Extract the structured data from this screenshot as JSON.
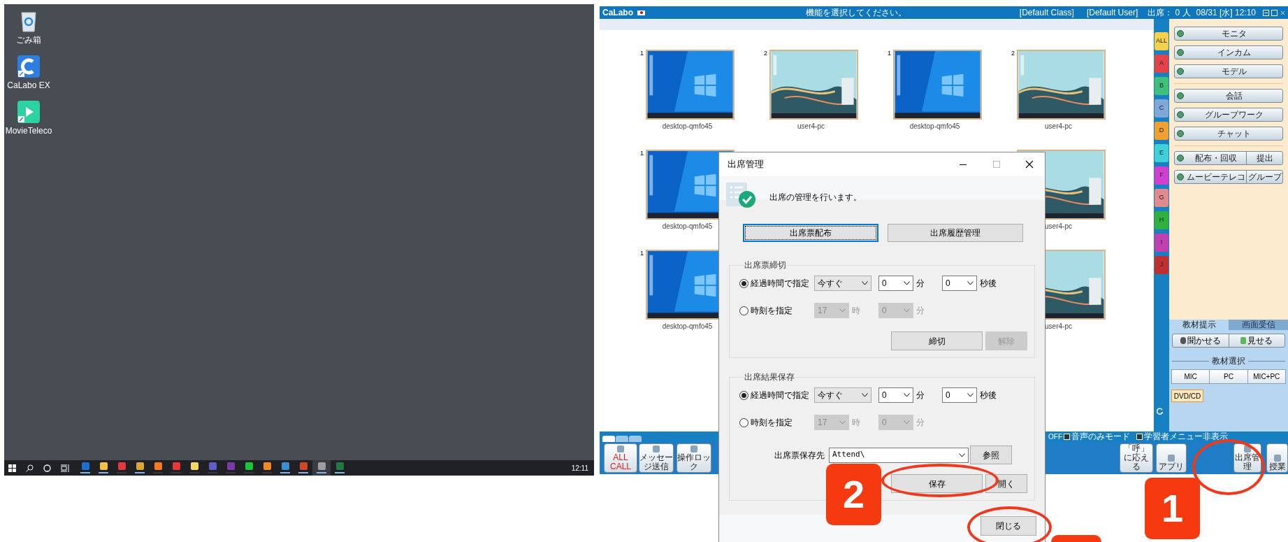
{
  "desktop": {
    "icons": [
      {
        "label": "ごみ箱",
        "kind": "trash"
      },
      {
        "label": "CaLabo EX",
        "kind": "calabo"
      },
      {
        "label": "MovieTeleco",
        "kind": "movie"
      }
    ],
    "taskbar": {
      "apps": [
        {
          "color": "#1e6fd0",
          "running": true
        },
        {
          "color": "#f5c242",
          "running": true
        },
        {
          "color": "#e5383b",
          "running": false
        },
        {
          "color": "#dda533",
          "running": true
        },
        {
          "color": "#f57a1f",
          "running": false
        },
        {
          "color": "#e53935",
          "running": false
        },
        {
          "color": "#f7d867",
          "running": false
        },
        {
          "color": "#5b5fc7",
          "running": false
        },
        {
          "color": "#7c3aa6",
          "running": false
        },
        {
          "color": "#19c43c",
          "running": false
        },
        {
          "color": "#f08a24",
          "running": false
        },
        {
          "color": "#3e8ed0",
          "running": true
        },
        {
          "color": "#d24726",
          "running": true
        },
        {
          "color": "#9aa0a6",
          "running": true
        },
        {
          "color": "#1f7a43",
          "running": true
        }
      ],
      "clock": "12:11"
    }
  },
  "app": {
    "title_bar": {
      "app_name": "CaLabo",
      "message": "機能を選択してください。",
      "class_name": "[Default Class]",
      "user_name": "[Default User]",
      "attendance": "出席： 0 人",
      "datetime": "08/31 [水] 12:10"
    },
    "thumbnail_rows": [
      {
        "cells": [
          {
            "number": "1",
            "label": "desktop-qmfo45"
          },
          {
            "number": "2",
            "label": "user4-pc"
          },
          {
            "number": "1",
            "label": "desktop-qmfo45"
          },
          {
            "number": "2",
            "label": "user4-pc"
          }
        ]
      },
      {
        "cells": [
          {
            "number": "1",
            "label": "desktop-qmfo45"
          },
          {
            "label": "user4-pc"
          }
        ]
      },
      {
        "cells": [
          {
            "number": "1",
            "label": "desktop-qmfo45"
          },
          {
            "label": "user4-pc"
          }
        ]
      }
    ],
    "group_tabs": [
      {
        "label": "ALL",
        "color": "#f5d04a"
      },
      {
        "label": "A",
        "color": "#e0434a"
      },
      {
        "label": "B",
        "color": "#3fbf7f"
      },
      {
        "label": "C",
        "color": "#7fa7d8"
      },
      {
        "label": "D",
        "color": "#f0a030"
      },
      {
        "label": "E",
        "color": "#3fd0d8"
      },
      {
        "label": "F",
        "color": "#d040d0"
      },
      {
        "label": "G",
        "color": "#e08a90"
      },
      {
        "label": "H",
        "color": "#30b040"
      },
      {
        "label": "I",
        "color": "#c040b0"
      },
      {
        "label": "J",
        "color": "#c03030"
      }
    ],
    "function_sections": [
      [
        {
          "label": "モニタ"
        },
        {
          "label": "インカム"
        },
        {
          "label": "モデル"
        }
      ],
      [
        {
          "label": "会話"
        },
        {
          "label": "グループワーク"
        },
        {
          "label": "チャット"
        }
      ],
      [
        {
          "label": "配布・回収",
          "side": "提出"
        },
        {
          "label": "ムービーテレコ",
          "side": "グループ"
        }
      ]
    ],
    "material_tabs": [
      {
        "label": "教材提示",
        "selected": true
      },
      {
        "label": "画面受信",
        "selected": false
      }
    ],
    "present_buttons": [
      "聞かせる",
      "見せる"
    ],
    "material_select_label": "教材選択",
    "sources": [
      {
        "label": "MIC",
        "selected": false
      },
      {
        "label": "PC",
        "selected": false
      },
      {
        "label": "MIC+PC",
        "selected": false
      }
    ],
    "extra_source": {
      "label": "DVD/CD",
      "selected": true
    },
    "view_tabs": [
      {
        "selected": true
      },
      {
        "selected": false
      },
      {
        "selected": false
      }
    ],
    "status_text": "OFF",
    "toggles": [
      {
        "label": "音声のみモード",
        "checked": true
      },
      {
        "label": "学習者メニュー非表示",
        "checked": true
      }
    ],
    "left_buttons": [
      {
        "label": "ALL CALL",
        "alert": true
      },
      {
        "label": "メッセージ送信",
        "alert": false
      },
      {
        "label": "操作ロック",
        "alert": false
      }
    ],
    "right_buttons": [
      {
        "label": "「呼」に応える"
      },
      {
        "label": "アプリ"
      },
      {
        "label": "出席管理"
      },
      {
        "label": "授業"
      }
    ]
  },
  "dialog": {
    "title": "出席管理",
    "description": "出席の管理を行います。",
    "top_buttons": [
      {
        "label": "出席票配布",
        "focused": true
      },
      {
        "label": "出席履歴管理",
        "focused": false
      }
    ],
    "groups": [
      {
        "title": "出席票締切",
        "rows": [
          {
            "label": "経過時間で指定",
            "selected": true,
            "disabled": false,
            "fields": [
              {
                "value": "今すぐ"
              },
              {
                "value": "0",
                "unit": "分"
              },
              {
                "value": "0",
                "unit": "秒後"
              }
            ]
          },
          {
            "label": "時刻を指定",
            "selected": false,
            "disabled": true,
            "fields": [
              {
                "value": "17",
                "unit": "時"
              },
              {
                "value": "0",
                "unit": "分"
              }
            ]
          }
        ],
        "actions": [
          {
            "label": "締切",
            "disabled": false
          },
          {
            "label": "解除",
            "disabled": true
          }
        ]
      },
      {
        "title": "出席結果保存",
        "rows": [
          {
            "label": "経過時間で指定",
            "selected": true,
            "disabled": false,
            "fields": [
              {
                "value": "今すぐ"
              },
              {
                "value": "0",
                "unit": "分"
              },
              {
                "value": "0",
                "unit": "秒後"
              }
            ]
          },
          {
            "label": "時刻を指定",
            "selected": false,
            "disabled": true,
            "fields": [
              {
                "value": "17",
                "unit": "時"
              },
              {
                "value": "0",
                "unit": "分"
              }
            ]
          }
        ],
        "save_path": {
          "label": "出席票保存先",
          "value": "Attend\\",
          "button": "参照"
        },
        "actions": [
          {
            "label": "保存",
            "disabled": false
          },
          {
            "label": "開く",
            "disabled": false
          }
        ]
      }
    ],
    "close_button": "閉じる"
  },
  "step_badges": [
    "1",
    "2"
  ]
}
